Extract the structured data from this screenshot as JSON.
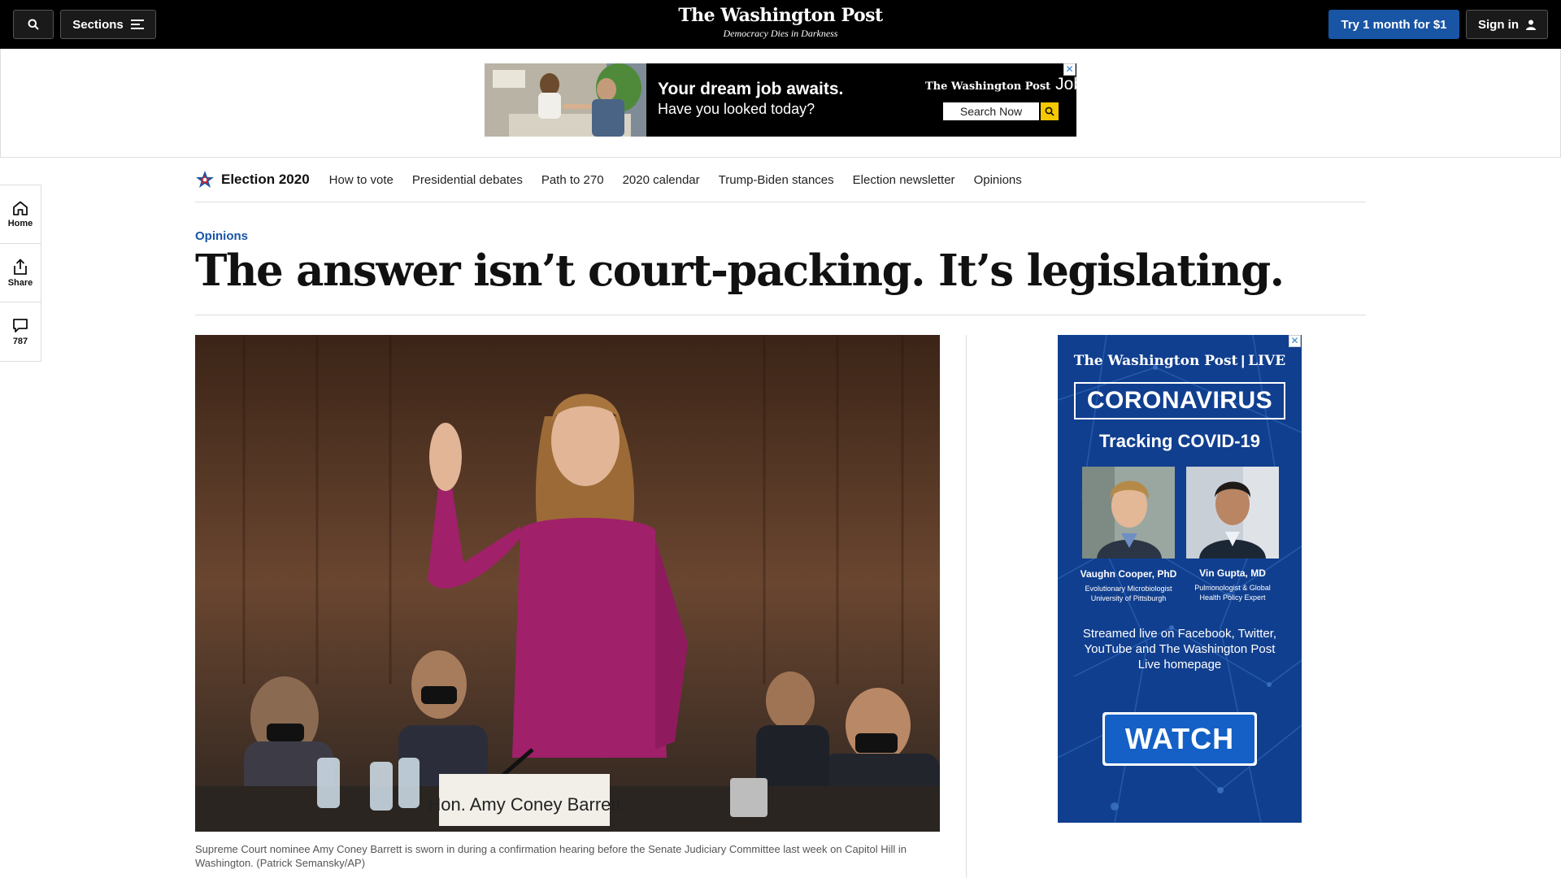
{
  "header": {
    "sections_label": "Sections",
    "logo": "The Washington Post",
    "tagline": "Democracy Dies in Darkness",
    "subscribe_label": "Try 1 month for $1",
    "signin_label": "Sign in"
  },
  "top_ad": {
    "headline": "Your dream job awaits.",
    "subhead": "Have you looked today?",
    "brand": "The Washington Post",
    "brand_suffix": "Jobs",
    "search_label": "Search Now"
  },
  "election_nav": {
    "title": "Election 2020",
    "links": [
      "How to vote",
      "Presidential debates",
      "Path to 270",
      "2020 calendar",
      "Trump-Biden stances",
      "Election newsletter",
      "Opinions"
    ]
  },
  "side_rail": {
    "home_label": "Home",
    "share_label": "Share",
    "comments_count": "787"
  },
  "article": {
    "kicker": "Opinions",
    "headline": "The answer isn’t court-packing. It’s legislating.",
    "photo_nameplate": "Hon. Amy Coney Barrett",
    "caption": "Supreme Court nominee Amy Coney Barrett is sworn in during a confirmation hearing before the Senate Judiciary Committee last week on Capitol Hill in Washington. (Patrick Semansky/AP)"
  },
  "side_ad": {
    "brand": "The Washington Post",
    "brand_suffix": "LIVE",
    "title": "CORONAVIRUS",
    "subtitle": "Tracking COVID-19",
    "guests": [
      {
        "name": "Vaughn Cooper, PhD",
        "role_line1": "Evolutionary Microbiologist",
        "role_line2": "University of Pittsburgh"
      },
      {
        "name": "Vin Gupta, MD",
        "role_line1": "Pulmonologist & Global",
        "role_line2": "Health Policy Expert"
      }
    ],
    "stream_text": "Streamed live on Facebook, Twitter, YouTube and The Washington Post Live homepage",
    "watch_label": "WATCH"
  },
  "colors": {
    "accent_blue": "#1955a5",
    "topbar": "#000000",
    "ad_blue": "#0f3d8a",
    "dress_magenta": "#a0206a"
  }
}
